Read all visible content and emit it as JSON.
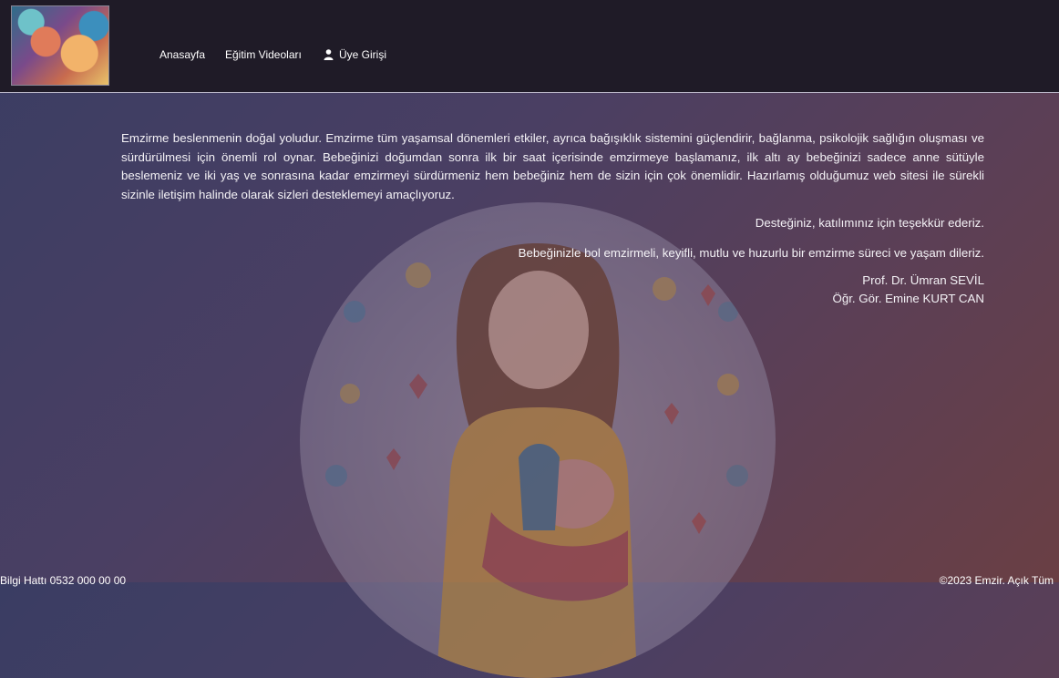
{
  "nav": {
    "home": "Anasayfa",
    "videos": "Eğitim Videoları",
    "login": "Üye Girişi"
  },
  "content": {
    "intro": "Emzirme beslenmenin doğal yoludur. Emzirme tüm yaşamsal dönemleri etkiler, ayrıca bağışıklık sistemini güçlendirir, bağlanma, psikolojik sağlığın oluşması  ve sürdürülmesi için önemli rol oynar. Bebeğinizi doğumdan sonra ilk bir saat içerisinde emzirmeye başlamanız, ilk altı ay bebeğinizi sadece anne sütüyle beslemeniz ve iki yaş ve sonrasına kadar emzirmeyi sürdürmeniz hem bebeğiniz hem de sizin için çok önemlidir. Hazırlamış olduğumuz web sitesi ile sürekli sizinle iletişim halinde olarak sizleri desteklemeyi amaçlıyoruz.",
    "thanks": "Desteğiniz, katılımınız için teşekkür ederiz.",
    "wish": "Bebeğinizle bol emzirmeli, keyifli, mutlu ve huzurlu bir emzirme süreci ve yaşam dileriz.",
    "signature_1": "Prof. Dr. Ümran SEVİL",
    "signature_2": "Öğr. Gör. Emine KURT CAN"
  },
  "footer": {
    "left": "Bilgi Hattı 0532 000 00 00",
    "right": "©2023 Emzir. Açık Tüm"
  },
  "icons": {
    "logo": "mother-baby-painting-logo",
    "user": "user-icon"
  },
  "colors": {
    "topbar": "#1f1b27",
    "text": "#f4f2f6"
  }
}
